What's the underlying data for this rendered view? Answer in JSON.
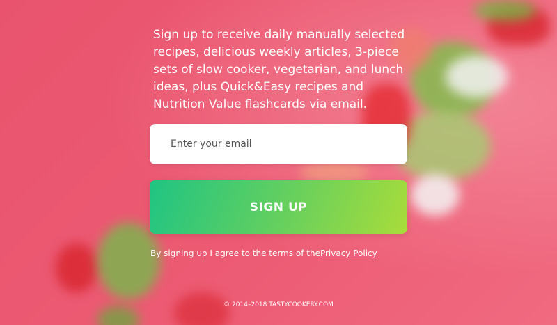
{
  "signup": {
    "intro_text": "Sign up to receive daily manually selected recipes, delicious weekly articles, 3-piece sets of slow cooker, vegetarian, and lunch ideas, plus Quick&Easy recipes and Nutrition Value flashcards via email.",
    "email_placeholder": "Enter your email",
    "button_label": "SIGN UP",
    "terms_text": "By signing up I agree to the terms of the",
    "privacy_link": "Privacy Policy"
  },
  "footer": {
    "copyright": "© 2014–2018 TASTYCOOKERY.COM"
  },
  "colors": {
    "background": "#ec5a72",
    "button_gradient_start": "#1fc483",
    "button_gradient_end": "#a9dc3a",
    "text": "#ffffff"
  }
}
